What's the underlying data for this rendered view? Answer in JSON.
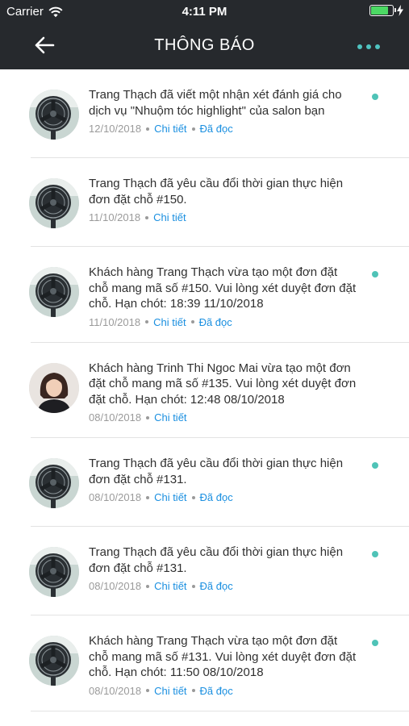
{
  "status_bar": {
    "carrier": "Carrier",
    "time": "4:11 PM",
    "battery_level": 0.8,
    "battery_color": "#4cd964"
  },
  "nav": {
    "title": "THÔNG BÁO",
    "back_icon": "arrow-left-icon",
    "more_icon": "more-horizontal-icon",
    "accent": "#4fc3c0"
  },
  "notifications": [
    {
      "avatar": "fan-photo",
      "message": "Trang Thạch đã viết một nhận xét đánh giá cho dịch vụ \"Nhuộm tóc highlight\" của salon bạn",
      "date": "12/10/2018",
      "detail_label": "Chi tiết",
      "read_label": "Đã đọc",
      "unread": true
    },
    {
      "avatar": "fan-photo",
      "message": "Trang Thạch đã yêu cầu đổi thời gian thực hiện đơn đặt chỗ #150.",
      "date": "11/10/2018",
      "detail_label": "Chi tiết",
      "read_label": "",
      "unread": false
    },
    {
      "avatar": "fan-photo",
      "message": "Khách hàng Trang Thạch vừa tạo một đơn đặt chỗ mang mã số #150. Vui lòng xét duyệt đơn đặt chỗ. Hạn chót: 18:39 11/10/2018",
      "date": "11/10/2018",
      "detail_label": "Chi tiết",
      "read_label": "Đã đọc",
      "unread": true
    },
    {
      "avatar": "person-photo",
      "message": "Khách hàng Trinh Thi Ngoc Mai vừa tạo một đơn đặt chỗ mang mã số #135. Vui lòng xét duyệt đơn đặt chỗ. Hạn chót: 12:48 08/10/2018",
      "date": "08/10/2018",
      "detail_label": "Chi tiết",
      "read_label": "",
      "unread": false
    },
    {
      "avatar": "fan-photo",
      "message": "Trang Thạch đã yêu cầu đổi thời gian thực hiện đơn đặt chỗ #131.",
      "date": "08/10/2018",
      "detail_label": "Chi tiết",
      "read_label": "Đã đọc",
      "unread": true
    },
    {
      "avatar": "fan-photo",
      "message": "Trang Thạch đã yêu cầu đổi thời gian thực hiện đơn đặt chỗ #131.",
      "date": "08/10/2018",
      "detail_label": "Chi tiết",
      "read_label": "Đã đọc",
      "unread": true
    },
    {
      "avatar": "fan-photo",
      "message": "Khách hàng Trang Thạch vừa tạo một đơn đặt chỗ mang mã số #131. Vui lòng xét duyệt đơn đặt chỗ. Hạn chót: 11:50 08/10/2018",
      "date": "08/10/2018",
      "detail_label": "Chi tiết",
      "read_label": "Đã đọc",
      "unread": true
    }
  ]
}
